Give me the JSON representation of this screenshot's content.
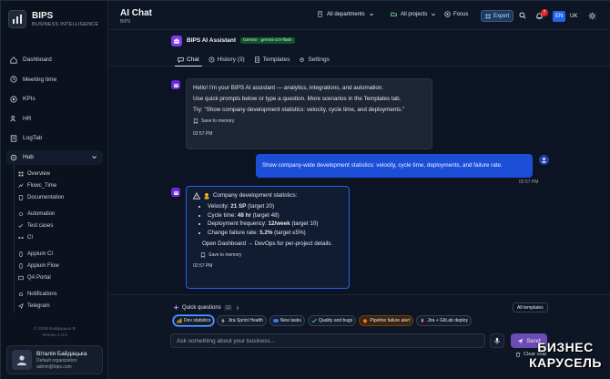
{
  "brand": {
    "name": "BIPS",
    "subtitle": "BUSINESS INTELLIGENCE"
  },
  "sidebar": {
    "items": [
      {
        "label": "Dashboard",
        "icon": "home-icon"
      },
      {
        "label": "Meeting time",
        "icon": "clock-icon"
      },
      {
        "label": "KPIs",
        "icon": "target-icon"
      },
      {
        "label": "HR",
        "icon": "users-icon"
      },
      {
        "label": "LogTab",
        "icon": "log-icon"
      }
    ],
    "hub": {
      "label": "Hub",
      "icon": "hub-icon"
    },
    "hub_items": [
      {
        "label": "Overview"
      },
      {
        "label": "Flowc_Time"
      },
      {
        "label": "Documentation"
      },
      {
        "label": "Automation"
      },
      {
        "label": "Test cases"
      },
      {
        "label": "CI"
      },
      {
        "label": "Appium CI"
      },
      {
        "label": "Appium Flow"
      },
      {
        "label": "QA Portal"
      },
      {
        "label": "Notifications"
      },
      {
        "label": "Telegram"
      }
    ],
    "copyright": "© 2026 Байдацька В",
    "version": "Version 1.0.0",
    "user": {
      "name": "Віталія Байдацька",
      "org": "Default organization",
      "email": "admin@bips.com"
    }
  },
  "header": {
    "title": "AI Chat",
    "subtitle": "BIPS",
    "departments": "All departments",
    "projects": "All projects",
    "focus": "Focus",
    "expert": "Expert",
    "notifications_count": "7",
    "lang_active": "EN",
    "lang_other": "UK"
  },
  "assistant": {
    "name": "BIPS AI Assistant",
    "model": "Gemini · gemini-3.0-flash",
    "tabs": [
      "Chat",
      "History (3)",
      "Templates",
      "Settings"
    ]
  },
  "messages": {
    "bot1": {
      "p1": "Hello! I'm your BIPS AI assistant — analytics, integrations, and automation.",
      "p2": "Use quick prompts below or type a question. More scenarios in the Templates tab.",
      "p3": "Try: \"Show company development statistics: velocity, cycle time, and deployments.\"",
      "save": "Save to memory",
      "time": "02:57 PM"
    },
    "user": {
      "text": "Show company-wide development statistics: velocity, cycle time, deployments, and failure rate.",
      "time": "02:57 PM"
    },
    "bot2": {
      "title": "Company development statistics:",
      "velocity_label": "Velocity:",
      "velocity_value": "21 SP",
      "velocity_target": "(target 20)",
      "cycle_label": "Cycle time:",
      "cycle_value": "48 hr",
      "cycle_target": "(target 48)",
      "deploy_label": "Deployment frequency:",
      "deploy_value": "12/week",
      "deploy_target": "(target 10)",
      "fail_label": "Change failure rate:",
      "fail_value": "5.2%",
      "fail_target": "(target ≤5%)",
      "note": "Open Dashboard → DevOps for per-project details.",
      "save": "Save to memory",
      "time": "02:57 PM"
    }
  },
  "composer": {
    "quick_label": "Quick questions",
    "quick_count": "12",
    "all_templates": "All templates",
    "chips": [
      "Dev statistics",
      "Jira Sprint Health",
      "New tasks",
      "Quality and bugs",
      "Pipeline failure alert",
      "Jira + GitLab deploy"
    ],
    "placeholder": "Ask something about your business...",
    "send": "Send",
    "clear": "Clear chat"
  },
  "watermark": {
    "line1": "БИЗНЕС",
    "line2": "КАРУСЕЛЬ"
  },
  "colors": {
    "accent": "#2563eb",
    "assistant": "#7c3aed",
    "send": "#6d4bb5"
  }
}
